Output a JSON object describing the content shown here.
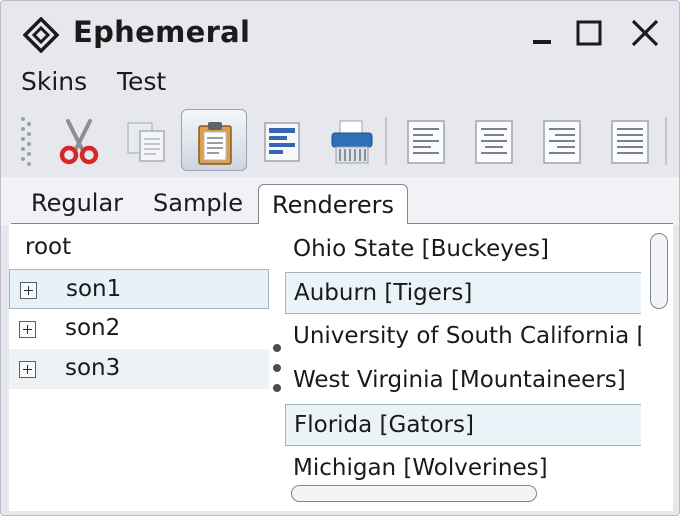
{
  "window": {
    "title": "Ephemeral"
  },
  "menu": {
    "items": [
      "Skins",
      "Test"
    ]
  },
  "toolbar": {
    "buttons": [
      "grip-icon",
      "cut-icon",
      "copy-icon",
      "paste-icon",
      "format-icon",
      "shredder-icon",
      "align-left-icon",
      "align-center-icon",
      "align-right-icon",
      "align-justify-icon"
    ],
    "active": "paste-icon"
  },
  "tabs": {
    "items": [
      "Regular",
      "Sample",
      "Renderers"
    ],
    "selected": "Renderers"
  },
  "tree": {
    "root": "root",
    "children": [
      "son1",
      "son2",
      "son3"
    ]
  },
  "list": {
    "items": [
      "Ohio State [Buckeyes]",
      "Auburn [Tigers]",
      "University of South California [Trojans]",
      "West Virginia [Mountaineers]",
      "Florida [Gators]",
      "Michigan [Wolverines]"
    ]
  },
  "colors": {
    "window_bg": "#e6e8ee",
    "selected_row": "#e7f1f7",
    "alt_row": "#eaf3f8",
    "scissor_red": "#d8262a"
  }
}
